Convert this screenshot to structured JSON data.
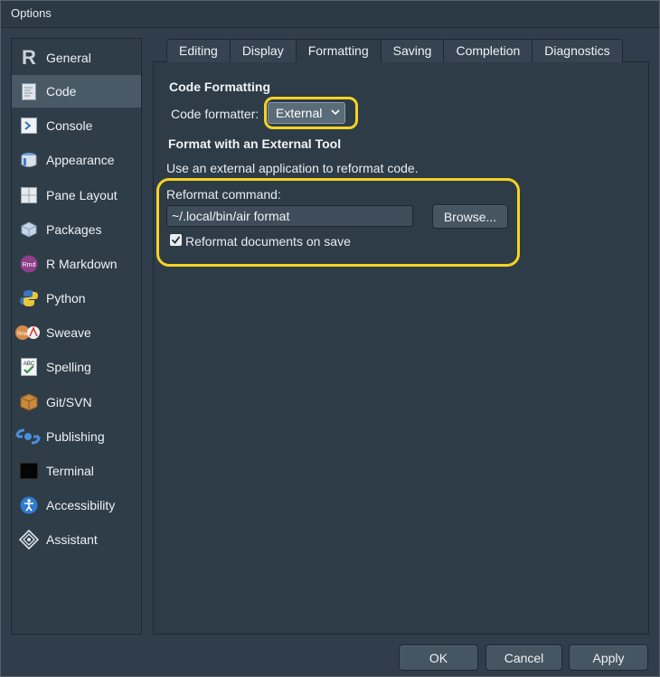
{
  "window": {
    "title": "Options"
  },
  "sidebar": {
    "items": [
      {
        "label": "General",
        "icon": "r-logo-icon",
        "active": false
      },
      {
        "label": "Code",
        "icon": "code-document-icon",
        "active": true
      },
      {
        "label": "Console",
        "icon": "console-prompt-icon",
        "active": false
      },
      {
        "label": "Appearance",
        "icon": "paint-bucket-icon",
        "active": false
      },
      {
        "label": "Pane Layout",
        "icon": "pane-grid-icon",
        "active": false
      },
      {
        "label": "Packages",
        "icon": "package-box-icon",
        "active": false
      },
      {
        "label": "R Markdown",
        "icon": "rmd-icon",
        "active": false
      },
      {
        "label": "Python",
        "icon": "python-icon",
        "active": false
      },
      {
        "label": "Sweave",
        "icon": "sweave-icon",
        "active": false
      },
      {
        "label": "Spelling",
        "icon": "spellcheck-icon",
        "active": false
      },
      {
        "label": "Git/SVN",
        "icon": "git-box-icon",
        "active": false
      },
      {
        "label": "Publishing",
        "icon": "publishing-icon",
        "active": false
      },
      {
        "label": "Terminal",
        "icon": "terminal-icon",
        "active": false
      },
      {
        "label": "Accessibility",
        "icon": "accessibility-icon",
        "active": false
      },
      {
        "label": "Assistant",
        "icon": "assistant-diamond-icon",
        "active": false
      }
    ]
  },
  "tabs": [
    {
      "label": "Editing",
      "active": false
    },
    {
      "label": "Display",
      "active": false
    },
    {
      "label": "Formatting",
      "active": true
    },
    {
      "label": "Saving",
      "active": false
    },
    {
      "label": "Completion",
      "active": false
    },
    {
      "label": "Diagnostics",
      "active": false
    }
  ],
  "formatting": {
    "code_formatting_heading": "Code Formatting",
    "formatter_label": "Code formatter:",
    "formatter_value": "External",
    "external_heading": "Format with an External Tool",
    "description": "Use an external application to reformat code.",
    "reformat_command_label": "Reformat command:",
    "reformat_command_value": "~/.local/bin/air format",
    "browse_label": "Browse...",
    "reformat_on_save_label": "Reformat documents on save",
    "reformat_on_save_checked": true
  },
  "footer": {
    "ok_label": "OK",
    "cancel_label": "Cancel",
    "apply_label": "Apply"
  },
  "colors": {
    "highlight": "#f5d323",
    "background": "#2f3e4a",
    "active_item": "#4a5966"
  }
}
